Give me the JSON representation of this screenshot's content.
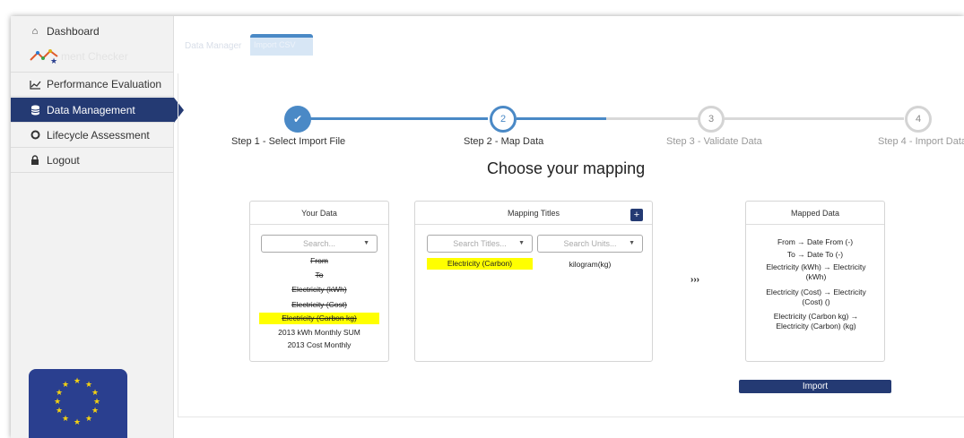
{
  "sidebar": {
    "items": [
      {
        "label": "Dashboard",
        "icon": "dashboard-icon",
        "glyph": "⌂"
      },
      {
        "label": "ment Checker",
        "icon": "checker-icon",
        "glyph": ""
      },
      {
        "label": "Performance Evaluation",
        "icon": "line-chart-icon",
        "glyph": "📈"
      },
      {
        "label": "Data Management",
        "icon": "database-icon",
        "glyph": "☰"
      },
      {
        "label": "Lifecycle Assessment",
        "icon": "circle-icon",
        "glyph": "○"
      },
      {
        "label": "Logout",
        "icon": "lock-icon",
        "glyph": "🔒"
      }
    ]
  },
  "topbar": {
    "ghost_tab": "Data Manager",
    "active_tab": "Import CSV"
  },
  "steps": [
    {
      "number": "✔",
      "label": "Step 1 - Select Import File",
      "state": "done"
    },
    {
      "number": "2",
      "label": "Step 2 - Map Data",
      "state": "current"
    },
    {
      "number": "3",
      "label": "Step 3 - Validate Data",
      "state": "todo"
    },
    {
      "number": "4",
      "label": "Step 4 - Import Data",
      "state": "todo"
    }
  ],
  "title": "Choose your mapping",
  "your_data": {
    "header": "Your Data",
    "search_placeholder": "Search...",
    "rows": [
      {
        "text": "From",
        "struck": true,
        "highlight": false
      },
      {
        "text": "To",
        "struck": true,
        "highlight": false
      },
      {
        "text": "Electricity (kWh)",
        "struck": true,
        "highlight": false
      },
      {
        "text": "Electricity (Cost)",
        "struck": true,
        "highlight": false
      },
      {
        "text": "Electricity (Carbon kg)",
        "struck": true,
        "highlight": true
      },
      {
        "text": "2013 kWh Monthly SUM",
        "struck": false,
        "highlight": false
      },
      {
        "text": "2013 Cost Monthly",
        "struck": false,
        "highlight": false
      }
    ]
  },
  "mapping_titles": {
    "header": "Mapping Titles",
    "plus_label": "+",
    "search_titles_placeholder": "Search Titles...",
    "search_units_placeholder": "Search Units...",
    "selected_title": "Electricity (Carbon)",
    "selected_unit": "kilogram(kg)"
  },
  "arrows": "›››",
  "mapped_data": {
    "header": "Mapped Data",
    "rows": [
      "From → Date From (-)",
      "To → Date To (-)",
      "Electricity (kWh) → Electricity (kWh)",
      "Electricity (Cost) → Electricity (Cost) ()",
      "Electricity (Carbon kg) → Electricity (Carbon) (kg)"
    ]
  },
  "import_label": "Import",
  "colors": {
    "navy": "#243a73",
    "step_blue": "#4a89c6",
    "highlight": "#ffff00"
  }
}
